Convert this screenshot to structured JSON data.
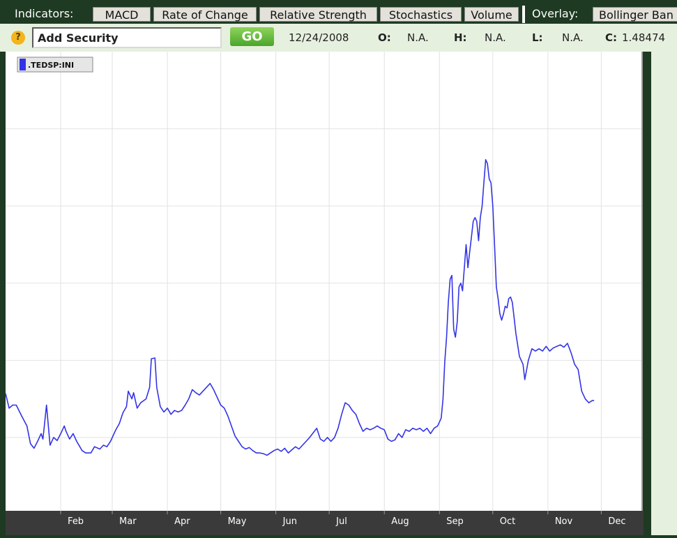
{
  "toolbar": {
    "indicators_label": "Indicators:",
    "buttons": [
      "MACD",
      "Rate of Change",
      "Relative Strength",
      "Stochastics",
      "Volume"
    ],
    "overlay_label": "Overlay:",
    "overlay_buttons": [
      "Bollinger Ban"
    ]
  },
  "infobar": {
    "help": "?",
    "add_security": "Add Security",
    "go": "GO",
    "date": "12/24/2008",
    "open_label": "O:",
    "open_value": "N.A.",
    "high_label": "H:",
    "high_value": "N.A.",
    "low_label": "L:",
    "low_value": "N.A.",
    "close_label": "C:",
    "close_value": "1.48474"
  },
  "chart_data": {
    "type": "line",
    "legend": [
      ".TEDSP:INI"
    ],
    "color": "#3333e6",
    "grid": true,
    "ylim": [
      0.05,
      6.0
    ],
    "yticks": [
      1,
      2,
      3,
      4,
      5
    ],
    "xlim": [
      1,
      359
    ],
    "months": [
      {
        "label": "Feb",
        "day": 32
      },
      {
        "label": "Mar",
        "day": 61
      },
      {
        "label": "Apr",
        "day": 92
      },
      {
        "label": "May",
        "day": 122
      },
      {
        "label": "Jun",
        "day": 153
      },
      {
        "label": "Jul",
        "day": 183
      },
      {
        "label": "Aug",
        "day": 214
      },
      {
        "label": "Sep",
        "day": 245
      },
      {
        "label": "Oct",
        "day": 275
      },
      {
        "label": "Nov",
        "day": 306
      },
      {
        "label": "Dec",
        "day": 336
      }
    ],
    "series": [
      {
        "values": [
          [
            1,
            1.57
          ],
          [
            3,
            1.38
          ],
          [
            5,
            1.42
          ],
          [
            7,
            1.42
          ],
          [
            10,
            1.28
          ],
          [
            13,
            1.15
          ],
          [
            15,
            0.92
          ],
          [
            17,
            0.86
          ],
          [
            19,
            0.95
          ],
          [
            21,
            1.05
          ],
          [
            22,
            0.98
          ],
          [
            24,
            1.42
          ],
          [
            26,
            0.9
          ],
          [
            28,
            1.0
          ],
          [
            30,
            0.96
          ],
          [
            32,
            1.05
          ],
          [
            34,
            1.15
          ],
          [
            35,
            1.08
          ],
          [
            37,
            0.98
          ],
          [
            39,
            1.05
          ],
          [
            41,
            0.95
          ],
          [
            44,
            0.83
          ],
          [
            46,
            0.8
          ],
          [
            49,
            0.8
          ],
          [
            51,
            0.88
          ],
          [
            54,
            0.85
          ],
          [
            56,
            0.9
          ],
          [
            58,
            0.88
          ],
          [
            60,
            0.95
          ],
          [
            63,
            1.1
          ],
          [
            65,
            1.18
          ],
          [
            67,
            1.32
          ],
          [
            69,
            1.4
          ],
          [
            70,
            1.6
          ],
          [
            72,
            1.5
          ],
          [
            73,
            1.58
          ],
          [
            75,
            1.38
          ],
          [
            77,
            1.45
          ],
          [
            80,
            1.5
          ],
          [
            82,
            1.65
          ],
          [
            83,
            2.02
          ],
          [
            85,
            2.03
          ],
          [
            86,
            1.65
          ],
          [
            88,
            1.4
          ],
          [
            90,
            1.33
          ],
          [
            92,
            1.38
          ],
          [
            94,
            1.3
          ],
          [
            96,
            1.35
          ],
          [
            98,
            1.33
          ],
          [
            100,
            1.35
          ],
          [
            102,
            1.42
          ],
          [
            104,
            1.5
          ],
          [
            106,
            1.62
          ],
          [
            108,
            1.58
          ],
          [
            110,
            1.55
          ],
          [
            112,
            1.6
          ],
          [
            114,
            1.65
          ],
          [
            116,
            1.7
          ],
          [
            118,
            1.62
          ],
          [
            120,
            1.52
          ],
          [
            122,
            1.42
          ],
          [
            124,
            1.38
          ],
          [
            126,
            1.28
          ],
          [
            128,
            1.15
          ],
          [
            130,
            1.02
          ],
          [
            132,
            0.95
          ],
          [
            134,
            0.88
          ],
          [
            136,
            0.85
          ],
          [
            138,
            0.87
          ],
          [
            140,
            0.83
          ],
          [
            142,
            0.8
          ],
          [
            144,
            0.8
          ],
          [
            146,
            0.79
          ],
          [
            148,
            0.77
          ],
          [
            150,
            0.8
          ],
          [
            152,
            0.83
          ],
          [
            154,
            0.85
          ],
          [
            156,
            0.82
          ],
          [
            158,
            0.86
          ],
          [
            160,
            0.8
          ],
          [
            162,
            0.84
          ],
          [
            164,
            0.88
          ],
          [
            166,
            0.85
          ],
          [
            168,
            0.9
          ],
          [
            170,
            0.95
          ],
          [
            172,
            1.0
          ],
          [
            174,
            1.06
          ],
          [
            176,
            1.12
          ],
          [
            178,
            0.98
          ],
          [
            180,
            0.95
          ],
          [
            182,
            1.0
          ],
          [
            184,
            0.95
          ],
          [
            186,
            1.0
          ],
          [
            188,
            1.12
          ],
          [
            190,
            1.3
          ],
          [
            192,
            1.45
          ],
          [
            194,
            1.42
          ],
          [
            196,
            1.35
          ],
          [
            198,
            1.3
          ],
          [
            200,
            1.18
          ],
          [
            202,
            1.08
          ],
          [
            204,
            1.12
          ],
          [
            206,
            1.1
          ],
          [
            208,
            1.12
          ],
          [
            210,
            1.15
          ],
          [
            212,
            1.12
          ],
          [
            214,
            1.1
          ],
          [
            216,
            0.98
          ],
          [
            218,
            0.95
          ],
          [
            220,
            0.97
          ],
          [
            222,
            1.05
          ],
          [
            224,
            1.0
          ],
          [
            226,
            1.1
          ],
          [
            228,
            1.08
          ],
          [
            230,
            1.12
          ],
          [
            232,
            1.1
          ],
          [
            234,
            1.12
          ],
          [
            236,
            1.08
          ],
          [
            238,
            1.12
          ],
          [
            240,
            1.05
          ],
          [
            242,
            1.12
          ],
          [
            244,
            1.15
          ],
          [
            246,
            1.25
          ],
          [
            247,
            1.5
          ],
          [
            248,
            1.98
          ],
          [
            249,
            2.3
          ],
          [
            250,
            2.75
          ],
          [
            251,
            3.05
          ],
          [
            252,
            3.1
          ],
          [
            253,
            2.4
          ],
          [
            254,
            2.3
          ],
          [
            255,
            2.5
          ],
          [
            256,
            2.95
          ],
          [
            257,
            3.0
          ],
          [
            258,
            2.9
          ],
          [
            259,
            3.2
          ],
          [
            260,
            3.5
          ],
          [
            261,
            3.2
          ],
          [
            262,
            3.4
          ],
          [
            263,
            3.6
          ],
          [
            264,
            3.8
          ],
          [
            265,
            3.85
          ],
          [
            266,
            3.8
          ],
          [
            267,
            3.55
          ],
          [
            268,
            3.85
          ],
          [
            269,
            4.0
          ],
          [
            270,
            4.3
          ],
          [
            271,
            4.6
          ],
          [
            272,
            4.55
          ],
          [
            273,
            4.35
          ],
          [
            274,
            4.3
          ],
          [
            275,
            4.0
          ],
          [
            276,
            3.5
          ],
          [
            277,
            2.95
          ],
          [
            278,
            2.8
          ],
          [
            279,
            2.6
          ],
          [
            280,
            2.52
          ],
          [
            281,
            2.6
          ],
          [
            282,
            2.7
          ],
          [
            283,
            2.68
          ],
          [
            284,
            2.8
          ],
          [
            285,
            2.82
          ],
          [
            286,
            2.75
          ],
          [
            287,
            2.55
          ],
          [
            288,
            2.35
          ],
          [
            290,
            2.05
          ],
          [
            292,
            1.95
          ],
          [
            293,
            1.75
          ],
          [
            295,
            2.0
          ],
          [
            297,
            2.15
          ],
          [
            299,
            2.12
          ],
          [
            301,
            2.15
          ],
          [
            303,
            2.12
          ],
          [
            305,
            2.18
          ],
          [
            307,
            2.12
          ],
          [
            309,
            2.16
          ],
          [
            311,
            2.18
          ],
          [
            313,
            2.2
          ],
          [
            315,
            2.17
          ],
          [
            317,
            2.22
          ],
          [
            319,
            2.1
          ],
          [
            321,
            1.95
          ],
          [
            323,
            1.88
          ],
          [
            325,
            1.6
          ],
          [
            327,
            1.5
          ],
          [
            329,
            1.45
          ],
          [
            331,
            1.48
          ],
          [
            332,
            1.48
          ]
        ]
      }
    ]
  }
}
